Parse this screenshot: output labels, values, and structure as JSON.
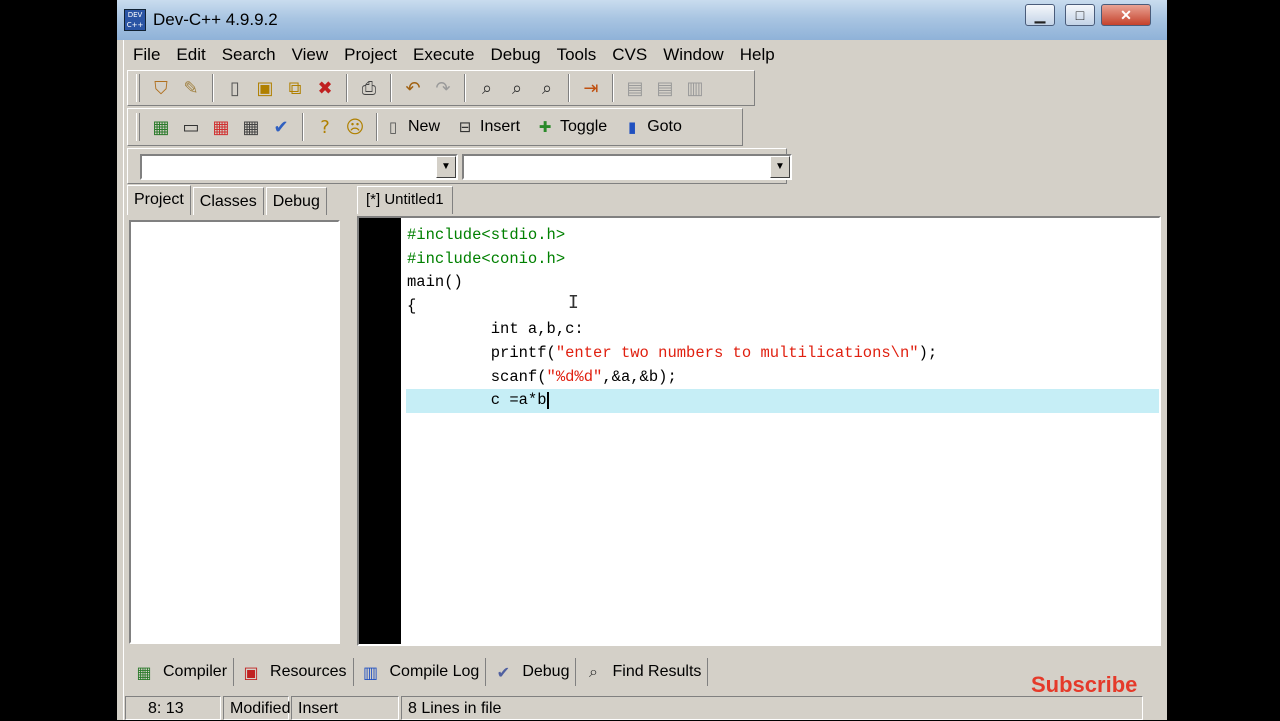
{
  "window": {
    "title": "Dev-C++ 4.9.9.2",
    "app_icon_text": "DEV C++",
    "minimize": "▁",
    "maximize": "□",
    "close": "✕"
  },
  "menu": [
    "File",
    "Edit",
    "Search",
    "View",
    "Project",
    "Execute",
    "Debug",
    "Tools",
    "CVS",
    "Window",
    "Help"
  ],
  "toolbar_main": {
    "icons": [
      "open-project-icon",
      "open-file-icon",
      "new-file-icon",
      "save-icon",
      "save-all-icon",
      "close-icon",
      "print-icon",
      "undo-icon",
      "redo-icon",
      "find-icon",
      "replace-icon",
      "find-next-icon",
      "goto-line-icon",
      "compile-icon",
      "run-icon",
      "rebuild-icon"
    ]
  },
  "toolbar_secondary": {
    "new_label": "New",
    "insert_label": "Insert",
    "toggle_label": "Toggle",
    "goto_label": "Goto"
  },
  "combos": {
    "left_value": "",
    "right_value": ""
  },
  "left_tabs": [
    "Project",
    "Classes",
    "Debug"
  ],
  "editor": {
    "tab_label": "[*] Untitled1",
    "lines": [
      [
        {
          "t": "#include<stdio.h>",
          "c": "pp"
        }
      ],
      [
        {
          "t": "#include<conio.h>",
          "c": "pp"
        }
      ],
      [
        {
          "t": "main()",
          "c": ""
        }
      ],
      [
        {
          "t": "{",
          "c": ""
        }
      ],
      [
        {
          "t": "         int a,b,c:",
          "c": ""
        }
      ],
      [
        {
          "t": "         printf(",
          "c": ""
        },
        {
          "t": "\"enter two numbers to multilications\\n\"",
          "c": "str"
        },
        {
          "t": ");",
          "c": ""
        }
      ],
      [
        {
          "t": "         scanf(",
          "c": ""
        },
        {
          "t": "\"%d%d\"",
          "c": "str"
        },
        {
          "t": ",&a,&b);",
          "c": ""
        }
      ],
      [
        {
          "t": "         c =a*b",
          "c": ""
        }
      ]
    ],
    "current_line": 8
  },
  "bottom_tabs": [
    {
      "label": "Compiler",
      "icon": "compiler-icon",
      "glyph": "▦"
    },
    {
      "label": "Resources",
      "icon": "resources-icon",
      "glyph": "▣"
    },
    {
      "label": "Compile Log",
      "icon": "compile-log-icon",
      "glyph": "▥"
    },
    {
      "label": "Debug",
      "icon": "debug-icon",
      "glyph": "✔"
    },
    {
      "label": "Find Results",
      "icon": "find-results-icon",
      "glyph": "⌕"
    }
  ],
  "overlay": {
    "subscribe": "Subscribe"
  },
  "status": {
    "position": "8: 13",
    "modified": "Modified",
    "mode": "Insert",
    "lines": "8 Lines in file"
  },
  "colors": {
    "preprocessor": "#008000",
    "string": "#e02010",
    "current_line_bg": "#c6eef6",
    "subscribe": "#e53a2a"
  }
}
